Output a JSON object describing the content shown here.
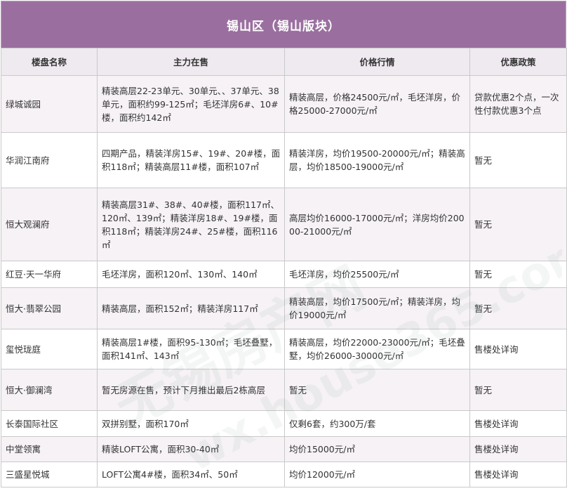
{
  "title": "锡山区（锡山版块）",
  "headers": [
    "楼盘名称",
    "主力在售",
    "价格行情",
    "优惠政策"
  ],
  "rows": [
    {
      "name": "绿城诚园",
      "sale": "精装高层22-23单元、30单元、、37单元、38单元，面积约99-125㎡；毛坯洋房6#、10#楼，面积约142㎡",
      "price": "精装高层，价格24500元/㎡，毛坯洋房，价格25000-27000元/㎡",
      "policy": "贷款优惠2个点，一次性付款优惠3个点"
    },
    {
      "name": "华润江南府",
      "sale": "四期产品，精装洋房15#、19#、20#楼，面积118㎡；精装高层11#楼，面积107㎡",
      "price": "精装洋房，均价19500-20000元/㎡；精装高层，均价18500-19000元/㎡",
      "policy": "暂无"
    },
    {
      "name": "恒大观澜府",
      "sale": "精装高层31#、38#、40#楼，面积117㎡、120㎡、139㎡；精装洋房18#、19#楼，面积118㎡；精装洋房24#、25#楼，面积116㎡",
      "price": "高层均价16000-17000元/㎡；洋房均价20000-21000元/㎡",
      "policy": "暂无"
    },
    {
      "name": "红豆·天一华府",
      "sale": "毛坯洋房，面积120㎡、130㎡、140㎡",
      "price": "毛坯洋房，均价25500元/㎡",
      "policy": "暂无"
    },
    {
      "name": "恒大·翡翠公园",
      "sale": "精装高层，面积152㎡；精装洋房117㎡",
      "price": "精装高层，均价17500元/㎡；精装洋房，均价19000元/㎡",
      "policy": "暂无"
    },
    {
      "name": "玺悦珑庭",
      "sale": "精装高层1#楼，面积95-130㎡；毛坯叠墅，面积141㎡、143㎡",
      "price": "精装高层，均价22000-23000元/㎡；毛坯叠墅，均价26000-30000元/㎡",
      "policy": "售楼处详询"
    },
    {
      "name": "恒大·御澜湾",
      "sale": "暂无房源在售，预计下月推出最后2栋高层",
      "price": "暂无",
      "policy": "暂无"
    },
    {
      "name": "长泰国际社区",
      "sale": "双拼别墅，面积170㎡",
      "price": "仅剩6套，约300万/套",
      "policy": "售楼处详询"
    },
    {
      "name": "中堂领寓",
      "sale": "精装LOFT公寓，面积30-40㎡",
      "price": "均价15000元/㎡",
      "policy": "售楼处详询"
    },
    {
      "name": "三盛星悦城",
      "sale": "LOFT公寓4#楼，面积34㎡、50㎡",
      "price": "均价12000元/㎡",
      "policy": "售楼处详询"
    }
  ],
  "watermark": {
    "line1": "无锡房产网",
    "line2": "wx.house365.com"
  }
}
